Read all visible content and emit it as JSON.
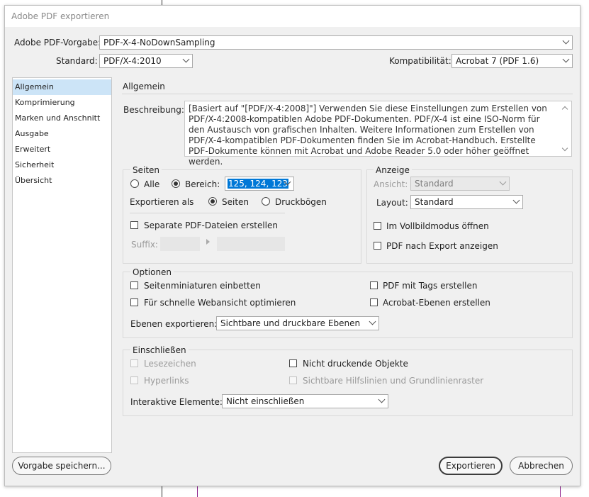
{
  "window": {
    "title": "Adobe PDF exportieren"
  },
  "header": {
    "preset_label": "Adobe PDF-Vorgabe:",
    "preset_value": "PDF-X-4-NoDownSampling",
    "standard_label": "Standard:",
    "standard_value": "PDF/X-4:2010",
    "compat_label": "Kompatibilität:",
    "compat_value": "Acrobat 7 (PDF 1.6)"
  },
  "sidebar": {
    "items": [
      {
        "label": "Allgemein"
      },
      {
        "label": "Komprimierung"
      },
      {
        "label": "Marken und Anschnitt"
      },
      {
        "label": "Ausgabe"
      },
      {
        "label": "Erweitert"
      },
      {
        "label": "Sicherheit"
      },
      {
        "label": "Übersicht"
      }
    ]
  },
  "main": {
    "title": "Allgemein",
    "description_label": "Beschreibung:",
    "description": "[Basiert auf \"[PDF/X-4:2008]\"] Verwenden Sie diese Einstellungen zum Erstellen von PDF/X-4:2008-kompatiblen Adobe PDF-Dokumenten. PDF/X-4 ist eine ISO-Norm für den Austausch von grafischen Inhalten. Weitere Informationen zum Erstellen von PDF/X-4-kompatiblen PDF-Dokumenten finden Sie im Acrobat-Handbuch. Erstellte PDF-Dokumente können mit Acrobat und Adobe Reader 5.0 oder höher geöffnet werden."
  },
  "seiten": {
    "title": "Seiten",
    "all_label": "Alle",
    "range_label": "Bereich:",
    "range_value": "125, 124, 123",
    "export_as_label": "Exportieren als",
    "pages_label": "Seiten",
    "spreads_label": "Druckbögen",
    "separate_label": "Separate PDF-Dateien erstellen",
    "suffix_label": "Suffix:"
  },
  "anzeige": {
    "title": "Anzeige",
    "view_label": "Ansicht:",
    "view_value": "Standard",
    "layout_label": "Layout:",
    "layout_value": "Standard",
    "fullscreen_label": "Im Vollbildmodus öffnen",
    "view_after_label": "PDF nach Export anzeigen"
  },
  "optionen": {
    "title": "Optionen",
    "thumbnails_label": "Seitenminiaturen einbetten",
    "fastweb_label": "Für schnelle Webansicht optimieren",
    "tagged_label": "PDF mit Tags erstellen",
    "layers_label": "Acrobat-Ebenen erstellen",
    "export_layers_label": "Ebenen exportieren:",
    "export_layers_value": "Sichtbare und druckbare Ebenen"
  },
  "einschliessen": {
    "title": "Einschließen",
    "bookmarks_label": "Lesezeichen",
    "hyperlinks_label": "Hyperlinks",
    "nonprinting_label": "Nicht druckende Objekte",
    "guides_label": "Sichtbare Hilfslinien und Grundlinienraster",
    "interactive_label": "Interaktive Elemente:",
    "interactive_value": "Nicht einschließen"
  },
  "footer": {
    "save_preset_label": "Vorgabe speichern...",
    "export_label": "Exportieren",
    "cancel_label": "Abbrechen"
  },
  "colors": {
    "selection_highlight": "#cce4f7",
    "text_selection": "#0078d7",
    "guide_line": "#8b1f8b"
  }
}
